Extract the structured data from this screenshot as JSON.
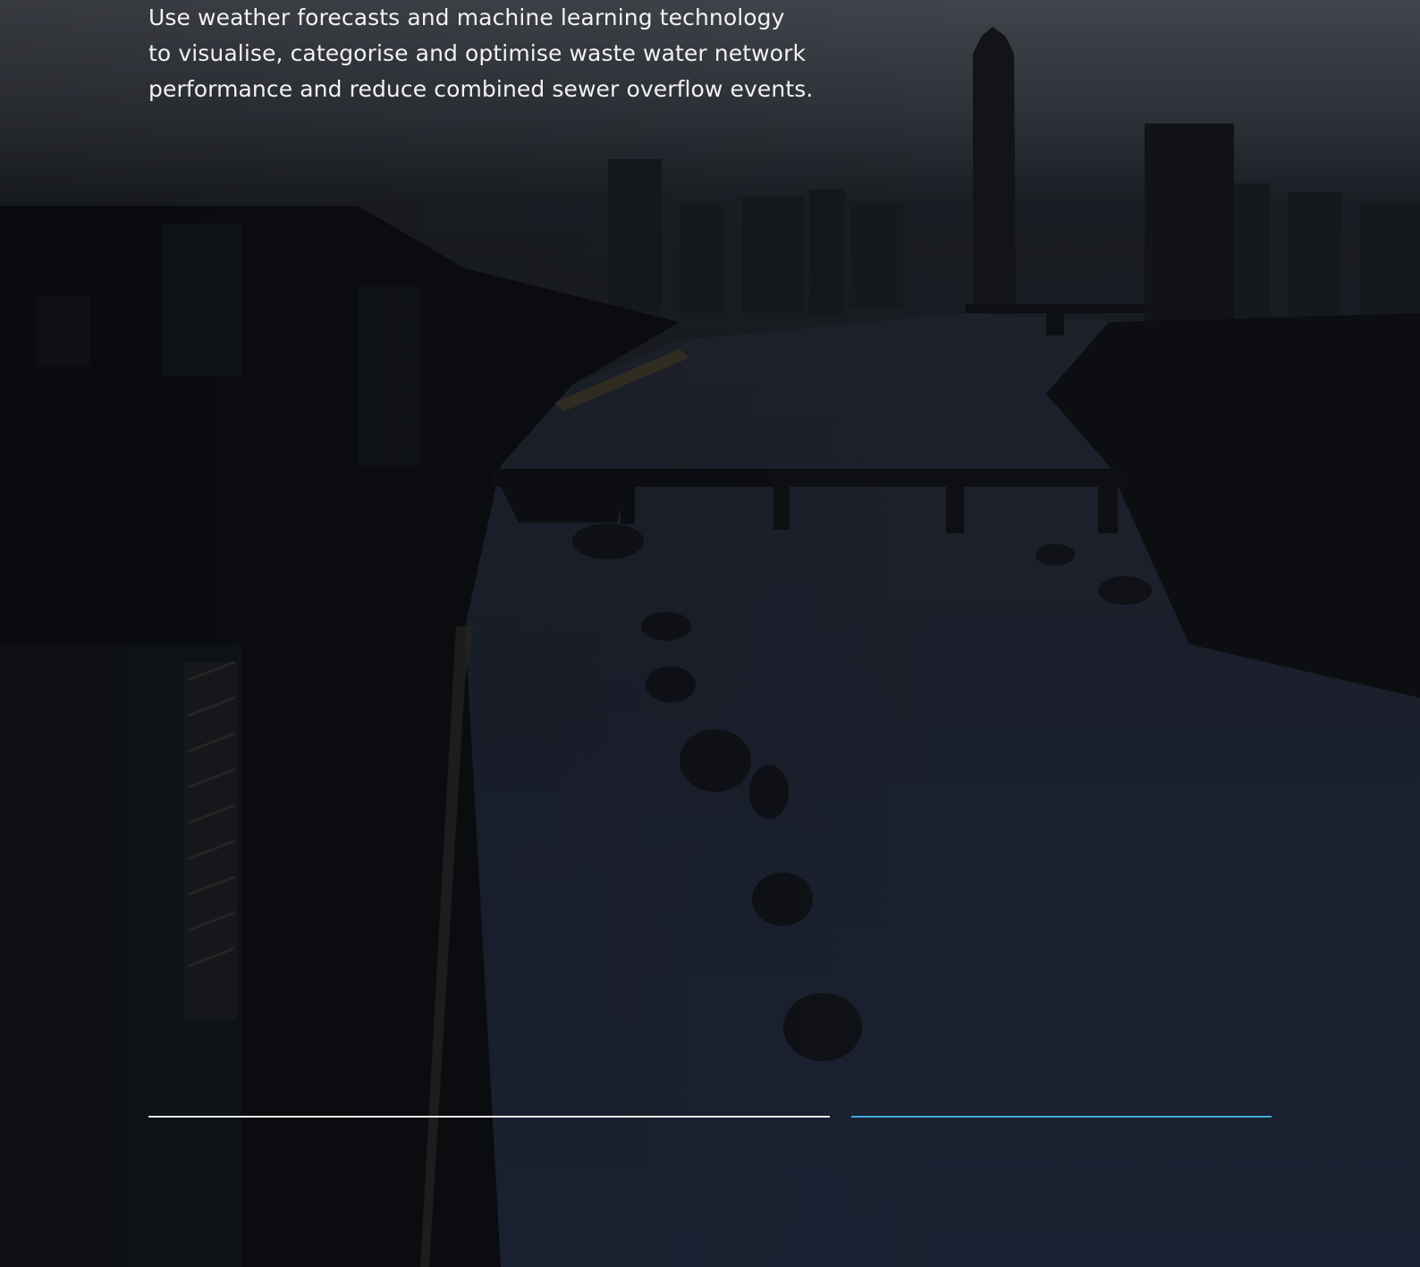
{
  "hero": {
    "intro_lines": [
      "Use weather forecasts and machine learning technology",
      "to visualise, categorise and optimise waste water network",
      "performance and reduce combined sewer overflow events."
    ]
  },
  "background": {
    "description_icon": "city-river-aerial-photo",
    "overlay_color": "#0e1117"
  },
  "dividers": {
    "left_color": "#e8e8e8",
    "right_color": "#3fa9dc"
  }
}
